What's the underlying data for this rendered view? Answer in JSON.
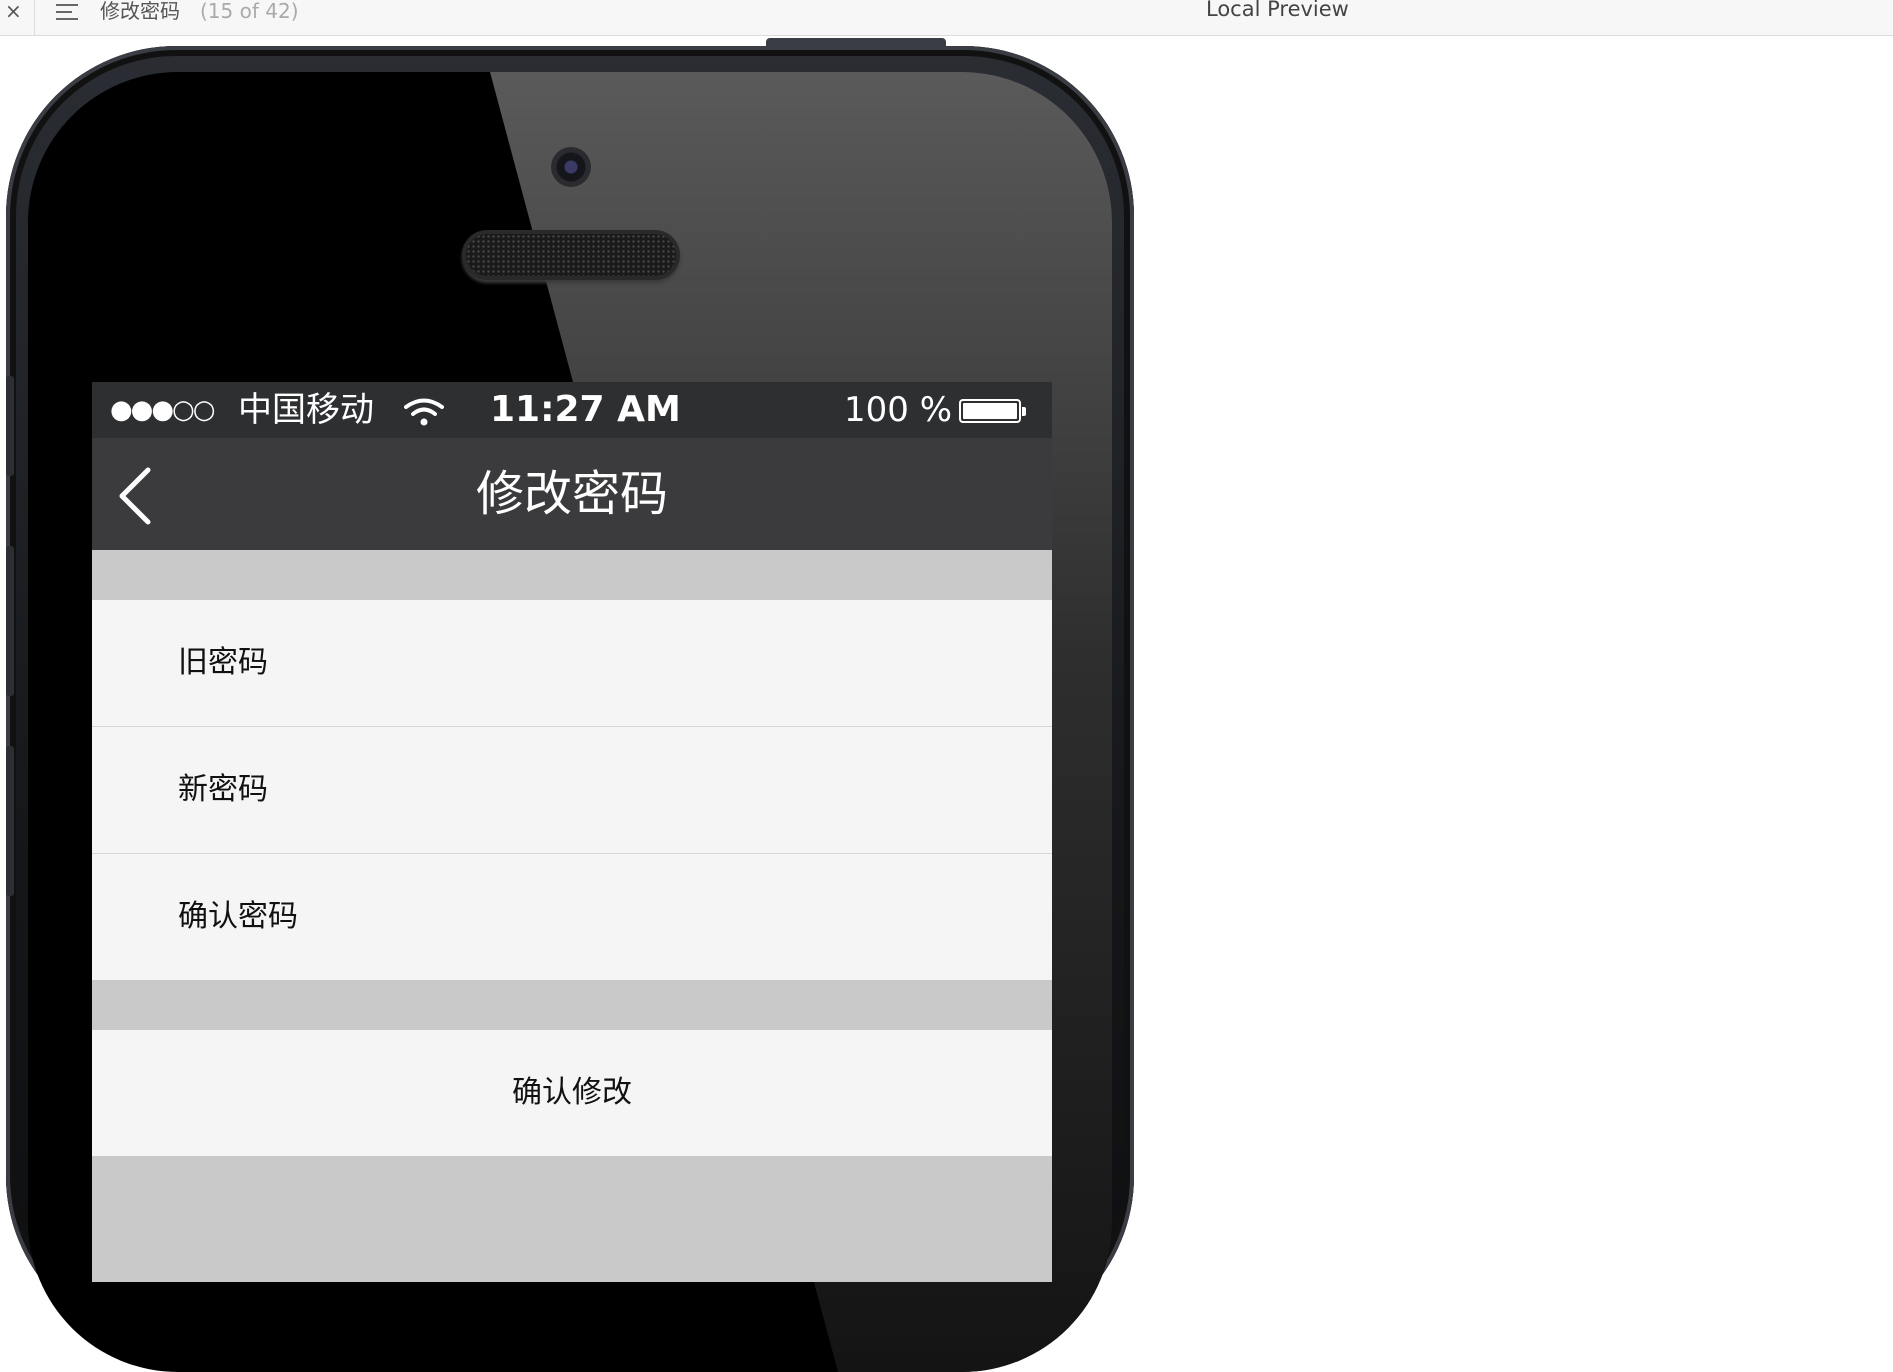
{
  "topbar": {
    "close_label": "×",
    "page_title": "修改密码",
    "page_count": "(15 of 42)",
    "preview_label": "Local Preview"
  },
  "status_bar": {
    "signal": "●●●○○",
    "carrier": "中国移动",
    "time": "11:27 AM",
    "battery_text": "100 %",
    "battery_level_percent": 100,
    "wifi_icon": "wifi-icon",
    "battery_icon": "battery-icon"
  },
  "navbar": {
    "title": "修改密码",
    "back_icon": "chevron-left-icon"
  },
  "form": {
    "fields": [
      {
        "label": "旧密码",
        "value": ""
      },
      {
        "label": "新密码",
        "value": ""
      },
      {
        "label": "确认密码",
        "value": ""
      }
    ],
    "submit_label": "确认修改"
  },
  "colors": {
    "statusbar_bg": "#2e2f31",
    "navbar_bg": "#3b3b3d",
    "cell_bg": "#f5f5f5",
    "screen_bg": "#c9c9c9"
  }
}
